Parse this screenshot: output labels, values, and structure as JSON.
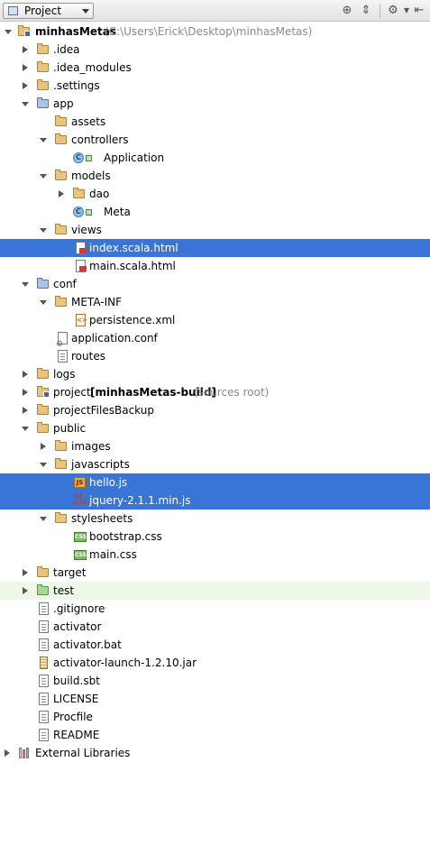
{
  "toolbar": {
    "view_selector": "Project",
    "icons": [
      "scroll-from-source-icon",
      "collapse-all-icon",
      "settings-gear-icon",
      "hide-panel-icon"
    ]
  },
  "tree": {
    "root": {
      "name": "minhasMetas",
      "path": "(C:\\Users\\Erick\\Desktop\\minhasMetas)"
    },
    "idea": ".idea",
    "idea_modules": ".idea_modules",
    "settings": ".settings",
    "app": "app",
    "assets": "assets",
    "controllers": "controllers",
    "application": "Application",
    "models": "models",
    "dao": "dao",
    "meta": "Meta",
    "views": "views",
    "index_scala": "index.scala.html",
    "main_scala": "main.scala.html",
    "conf": "conf",
    "meta_inf": "META-INF",
    "persistence": "persistence.xml",
    "application_conf": "application.conf",
    "routes": "routes",
    "logs": "logs",
    "project": {
      "name": "project",
      "module": "[minhasMetas-build]",
      "hint": "(sources root)"
    },
    "project_files_backup": "projectFilesBackup",
    "public": "public",
    "images": "images",
    "javascripts": "javascripts",
    "hello_js": "hello.js",
    "jquery_js": "jquery-2.1.1.min.js",
    "stylesheets": "stylesheets",
    "bootstrap_css": "bootstrap.css",
    "main_css": "main.css",
    "target": "target",
    "test": "test",
    "gitignore": ".gitignore",
    "activator": "activator",
    "activator_bat": "activator.bat",
    "activator_jar": "activator-launch-1.2.10.jar",
    "build_sbt": "build.sbt",
    "license": "LICENSE",
    "procfile": "Procfile",
    "readme": "README",
    "external_libraries": "External Libraries"
  },
  "colors": {
    "selection": "#3875d7",
    "test_folder_highlight": "#eff8e8",
    "path_hint": "#8a8a8a"
  }
}
